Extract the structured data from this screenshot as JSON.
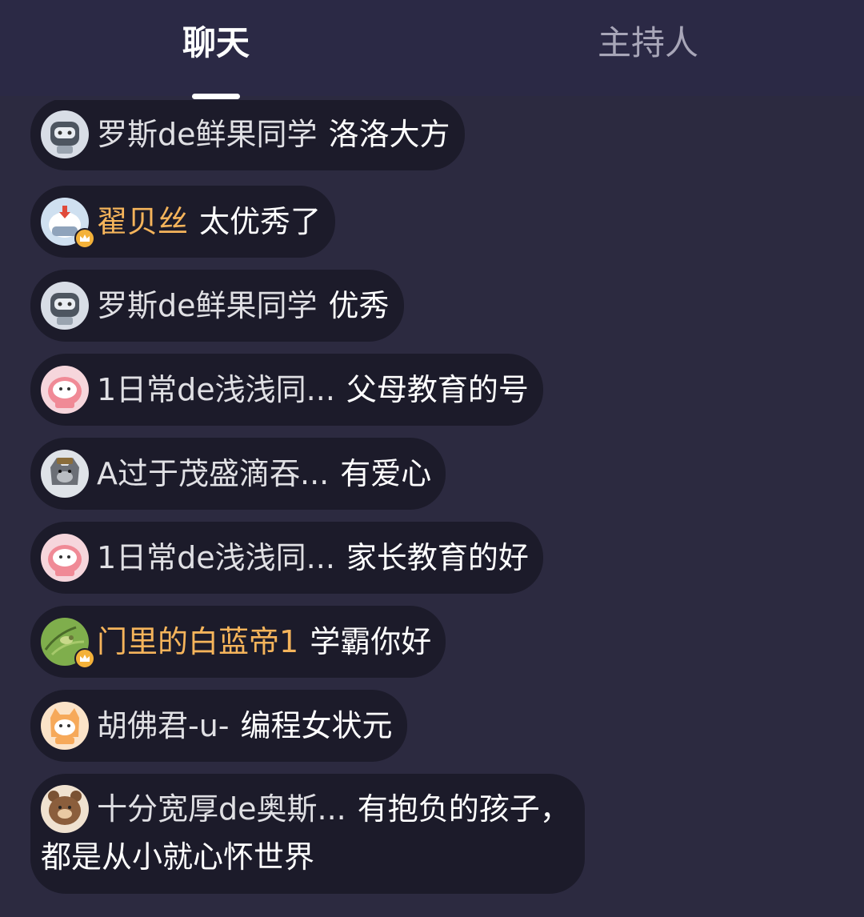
{
  "tabs": {
    "chat": "聊天",
    "host": "主持人"
  },
  "colors": {
    "background": "#2c2a40",
    "bubble": "#1c1b2a",
    "vip_name": "#f5b45b",
    "crown_badge": "#f4b23a"
  },
  "messages": [
    {
      "avatar": "robot-avatar",
      "nick": "罗斯de鲜果同学",
      "text": "洛洛大方",
      "vip": false
    },
    {
      "avatar": "robot-red-avatar",
      "nick": "翟贝丝",
      "text": "太优秀了",
      "vip": true
    },
    {
      "avatar": "robot-avatar",
      "nick": "罗斯de鲜果同学",
      "text": "优秀",
      "vip": false
    },
    {
      "avatar": "pink-pig-avatar",
      "nick": "1日常de浅浅同...",
      "text": "父母教育的号",
      "vip": false
    },
    {
      "avatar": "gray-wolf-avatar",
      "nick": "A过于茂盛滴吞...",
      "text": "有爱心",
      "vip": false
    },
    {
      "avatar": "pink-pig-avatar",
      "nick": "1日常de浅浅同...",
      "text": "家长教育的好",
      "vip": false
    },
    {
      "avatar": "bird-photo-avatar",
      "nick": "门里的白蓝帝1",
      "text": "学霸你好",
      "vip": true
    },
    {
      "avatar": "orange-cat-avatar",
      "nick": "胡佛君-u-",
      "text": "编程女状元",
      "vip": false
    },
    {
      "avatar": "brown-bear-avatar",
      "nick": "十分宽厚de奥斯...",
      "text": "有抱负的孩子，",
      "text_line2": "都是从小就心怀世界",
      "vip": false
    }
  ]
}
